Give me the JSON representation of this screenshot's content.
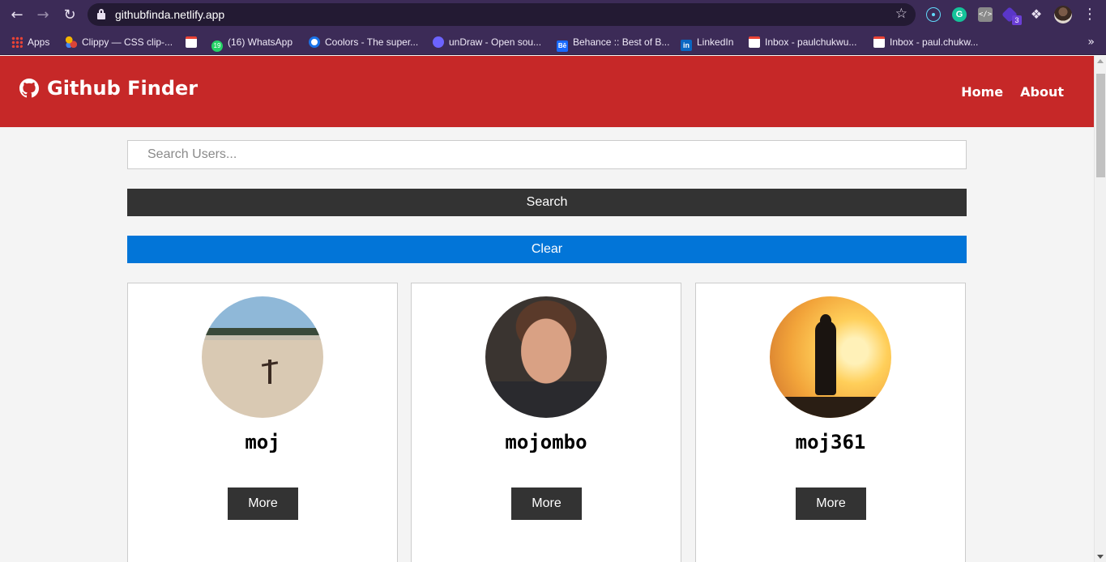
{
  "browser": {
    "url": "githubfinda.netlify.app",
    "extension_badge": "3",
    "bookmarks": [
      {
        "label": "Apps"
      },
      {
        "label": "Clippy — CSS clip-..."
      },
      {
        "label": ""
      },
      {
        "label": "(16) WhatsApp"
      },
      {
        "label": "Coolors - The super..."
      },
      {
        "label": "unDraw - Open sou..."
      },
      {
        "label": "Behance :: Best of B..."
      },
      {
        "label": "LinkedIn"
      },
      {
        "label": "Inbox - paulchukwu..."
      },
      {
        "label": "Inbox  - paul.chukw..."
      }
    ],
    "whatsapp_count": "19"
  },
  "navbar": {
    "brand": "Github Finder",
    "brand_icon": "github-icon",
    "links": [
      "Home",
      "About"
    ],
    "color": "#c62828"
  },
  "search": {
    "placeholder": "Search Users...",
    "value": "",
    "search_label": "Search",
    "clear_label": "Clear"
  },
  "users": [
    {
      "login": "moj",
      "button": "More",
      "avatar": "beach-photo"
    },
    {
      "login": "mojombo",
      "button": "More",
      "avatar": "portrait-photo"
    },
    {
      "login": "moj361",
      "button": "More",
      "avatar": "sunset-silhouette-photo"
    }
  ],
  "colors": {
    "primary": "#c62828",
    "dark": "#333333",
    "clear": "#0275d8",
    "chrome": "#3c2b57"
  }
}
